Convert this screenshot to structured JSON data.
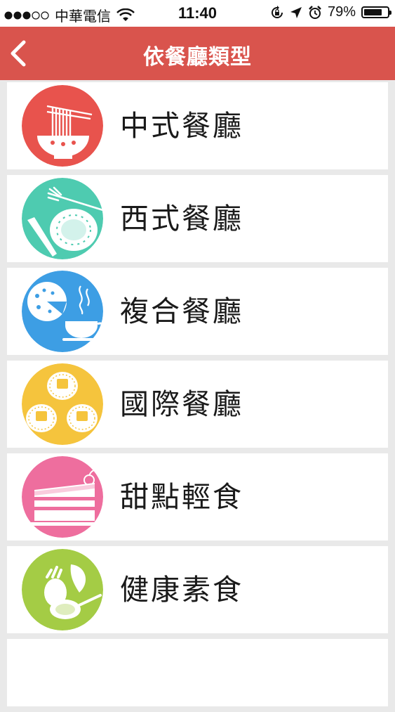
{
  "status": {
    "carrier": "中華電信",
    "time": "11:40",
    "battery": "79%",
    "battery_level": 0.79
  },
  "nav": {
    "title": "依餐廳類型",
    "back_icon": "chevron-left-icon"
  },
  "categories": [
    {
      "label": "中式餐廳",
      "icon": "noodle-bowl-icon",
      "color": "#e8534d"
    },
    {
      "label": "西式餐廳",
      "icon": "fork-plate-knife-icon",
      "color": "#4ecbb0"
    },
    {
      "label": "複合餐廳",
      "icon": "pizza-teacup-icon",
      "color": "#3d9ee4"
    },
    {
      "label": "國際餐廳",
      "icon": "dim-sum-icon",
      "color": "#f5c43d"
    },
    {
      "label": "甜點輕食",
      "icon": "cake-slice-icon",
      "color": "#ee6e9e"
    },
    {
      "label": "健康素食",
      "icon": "vegetables-spoon-icon",
      "color": "#a4cc45"
    }
  ],
  "colors": {
    "header": "#d9544d",
    "background": "#e9e9e9",
    "row": "#ffffff"
  }
}
